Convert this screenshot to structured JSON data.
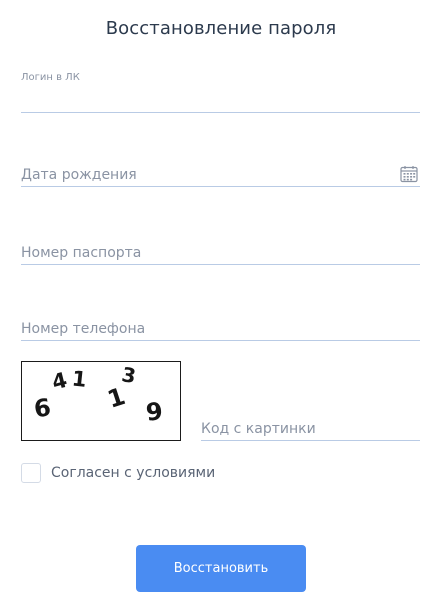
{
  "form": {
    "title": "Восстановление пароля",
    "login": {
      "label": "Логин в ЛК",
      "value": ""
    },
    "birth_date": {
      "placeholder": "Дата рождения",
      "icon": "calendar-icon"
    },
    "passport": {
      "placeholder": "Номер паспорта"
    },
    "phone": {
      "placeholder": "Номер телефона"
    },
    "captcha": {
      "image_text": "641139",
      "placeholder": "Код с картинки"
    },
    "agreement": {
      "label": "Согласен с условиями",
      "checked": false
    },
    "submit_label": "Восстановить"
  },
  "colors": {
    "accent": "#4a8cf2",
    "underline": "#b9cbe5",
    "placeholder": "#8a93a3",
    "title": "#2c3a4d"
  }
}
